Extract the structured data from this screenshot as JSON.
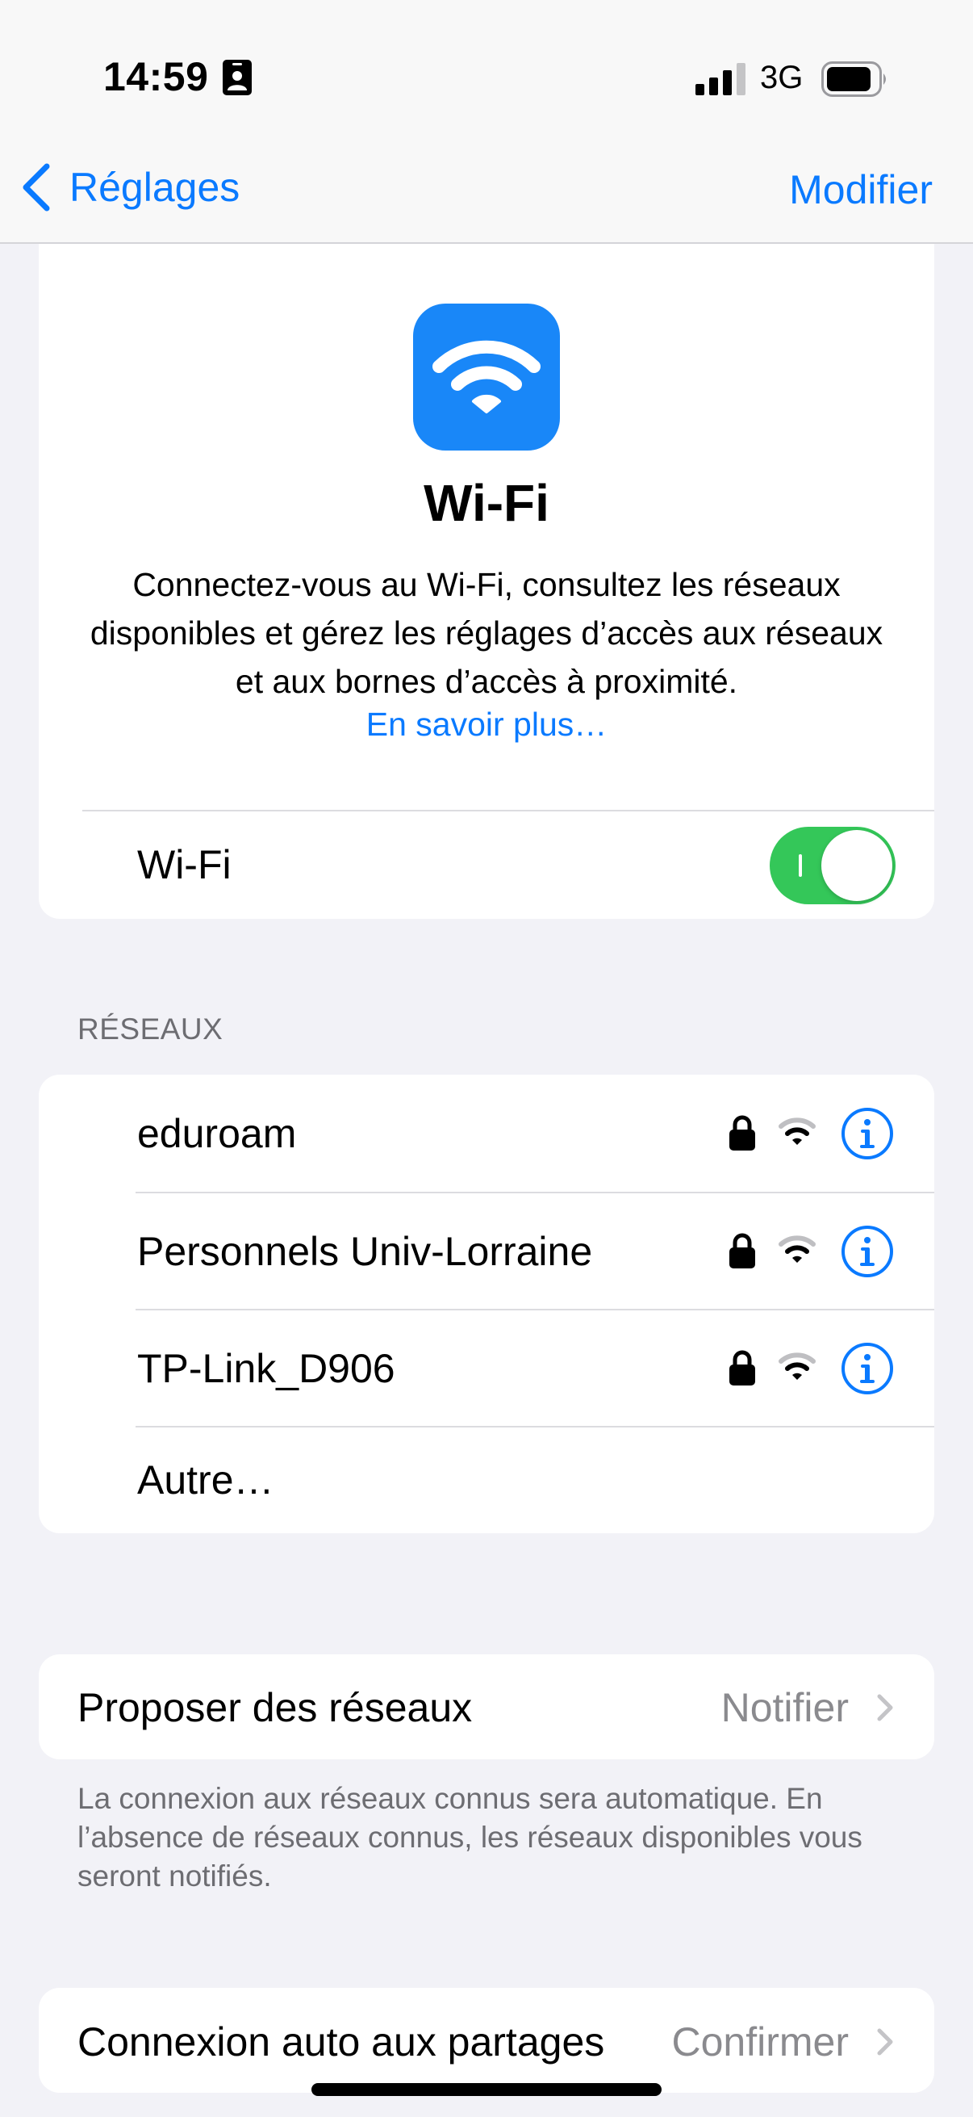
{
  "status": {
    "time": "14:59",
    "network": "3G"
  },
  "nav": {
    "back_label": "Réglages",
    "edit_label": "Modifier"
  },
  "hero": {
    "title": "Wi-Fi",
    "description": "Connectez-vous au Wi-Fi, consultez les réseaux disponibles et gérez les réglages d’accès aux réseaux et aux bornes d’accès à proximité.",
    "link": "En savoir plus…",
    "toggle_label": "Wi-Fi",
    "toggle_on": true
  },
  "networks": {
    "header": "RÉSEAUX",
    "items": [
      {
        "name": "eduroam"
      },
      {
        "name": "Personnels Univ-Lorraine"
      },
      {
        "name": "TP-Link_D906"
      }
    ],
    "other_label": "Autre…"
  },
  "suggest": {
    "label": "Proposer des réseaux",
    "value": "Notifier",
    "footnote": "La connexion aux réseaux connus sera automatique. En l’absence de réseaux connus, les réseaux disponibles vous seront notifiés."
  },
  "auto_join": {
    "label": "Connexion auto aux partages",
    "value": "Confirmer"
  },
  "colors": {
    "accent": "#0a7aff",
    "toggle_on": "#34c759",
    "app_icon": "#1987f8"
  }
}
